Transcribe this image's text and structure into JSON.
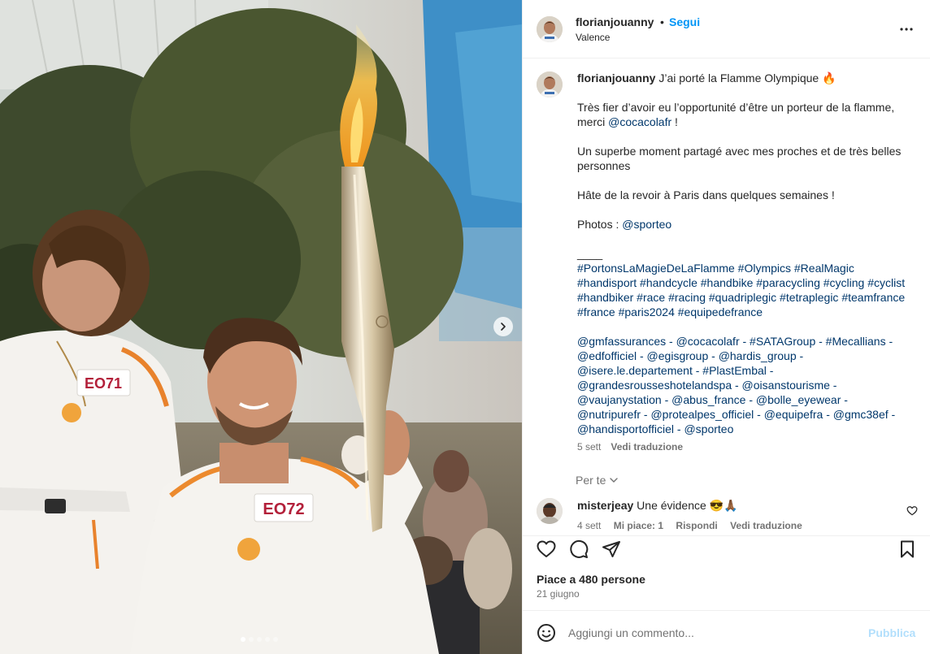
{
  "post": {
    "username": "florianjouanny",
    "follow_label": "Segui",
    "separator": "•",
    "location": "Valence"
  },
  "photo": {
    "bib_left": "EO71",
    "bib_right": "EO72"
  },
  "caption": {
    "username": "florianjouanny",
    "first_line": "J’ai porté la Flamme Olympique 🔥",
    "para1_text": "Très fier d’avoir eu l’opportunité d’être un porteur de la flamme, merci ",
    "para1_mention": "@cocacolafr",
    "para1_end": " !",
    "para2": "Un superbe moment partagé avec mes proches et de très belles personnes",
    "para3": "Hâte de la revoir à Paris dans quelques semaines !",
    "photos_label": "Photos : ",
    "photos_mention": "@sporteo",
    "divider": "____",
    "hashtags": "#PortonsLaMagieDeLaFlamme #Olympics #RealMagic #handisport #handcycle #handbike #paracycling #cycling #cyclist #handbiker #race #racing #quadriplegic #tetraplegic #teamfrance #france #paris2024 #equipedefrance",
    "mentions": "@gmfassurances - @cocacolafr - #SATAGroup - #Mecallians - @edfofficiel - @egisgroup - @hardis_group - @isere.le.departement - #PlastEmbal - @grandesrousseshotelandspa - @oisanstourisme - @vaujanystation - @abus_france - @bolle_eyewear - @nutripurefr - @protealpes_officiel - @equipefra - @gmc38ef - @handisportofficiel - @sporteo",
    "time": "5 sett",
    "translate": "Vedi traduzione"
  },
  "for_you": "Per te",
  "reply": {
    "username": "misterjeay",
    "text": "Une évidence 😎🙏🏾",
    "time": "4 sett",
    "likes": "Mi piace: 1",
    "respond": "Rispondi",
    "translate": "Vedi traduzione"
  },
  "engagement": {
    "likes": "Piace a 480 persone",
    "date": "21 giugno"
  },
  "composer": {
    "placeholder": "Aggiungi un commento...",
    "publish": "Pubblica"
  },
  "colors": {
    "link": "#0095f6",
    "mention": "#00376b",
    "publish_disabled": "#b2dffc"
  },
  "icons": [
    "more-icon",
    "chevron-right-icon",
    "chevron-down-icon",
    "heart-icon",
    "comment-icon",
    "share-icon",
    "save-icon",
    "emoji-icon"
  ]
}
